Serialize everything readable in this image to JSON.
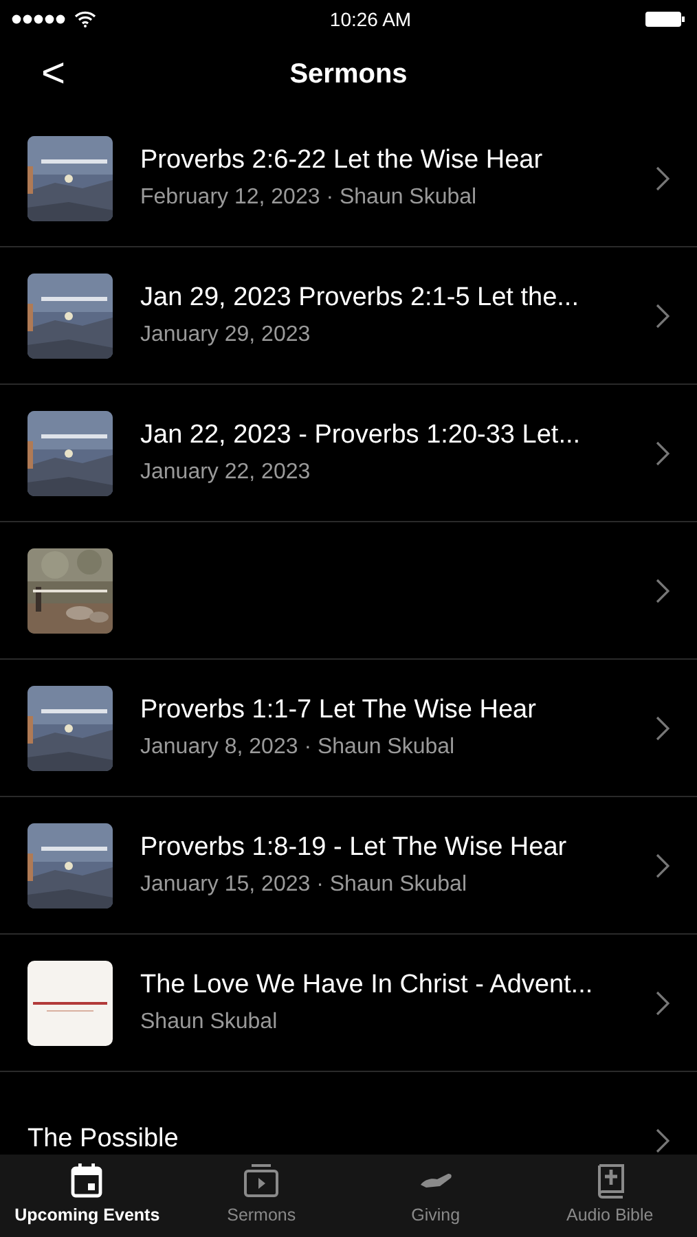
{
  "status_bar": {
    "time": "10:26 AM"
  },
  "nav": {
    "back": "<",
    "title": "Sermons"
  },
  "sermons": [
    {
      "thumbnail": {
        "kind": "picture"
      },
      "title": "Proverbs 2:6-22 Let the Wise Hear",
      "subtitle": "February 12, 2023 · Shaun Skubal"
    },
    {
      "thumbnail": {
        "kind": "picture"
      },
      "title": "Jan 29, 2023  Proverbs 2:1-5 Let the...",
      "subtitle": "January 29, 2023"
    },
    {
      "thumbnail": {
        "kind": "picture"
      },
      "title": "Jan 22, 2023  - Proverbs 1:20-33 Let...",
      "subtitle": "January 22, 2023"
    },
    {
      "thumbnail": {
        "kind": "picture"
      }
    },
    {
      "thumbnail": {
        "kind": "picture"
      },
      "title": "Proverbs 1:1-7 Let The Wise Hear",
      "subtitle": "January 8, 2023 · Shaun Skubal"
    },
    {
      "thumbnail": {
        "kind": "picture"
      },
      "title": "Proverbs 1:8-19 - Let The Wise Hear",
      "subtitle": "January 15, 2023 · Shaun Skubal"
    },
    {
      "thumbnail": {
        "kind": "picture"
      },
      "title": "The Love We Have In Christ - Advent...",
      "subtitle": "Shaun Skubal"
    },
    {
      "title": "The Possible"
    }
  ],
  "tabs": [
    {
      "kind": "calendar",
      "label": "Upcoming Events",
      "selected": true
    },
    {
      "kind": "video",
      "label": "Sermons",
      "selected": false
    },
    {
      "kind": "giving",
      "label": "Giving",
      "selected": false
    },
    {
      "kind": "bible",
      "label": "Audio Bible",
      "selected": false
    }
  ]
}
